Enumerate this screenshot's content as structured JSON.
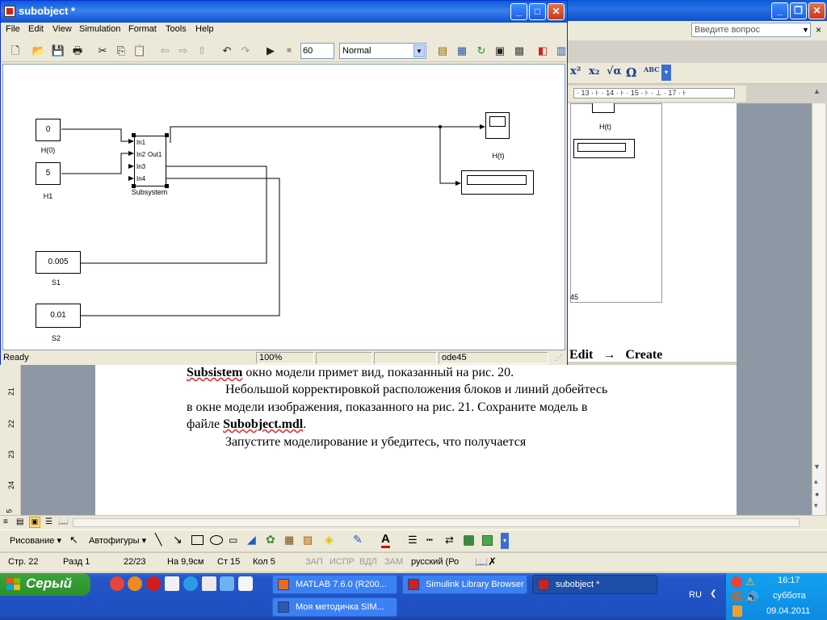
{
  "word": {
    "ask_placeholder": "Введите вопрос",
    "ruler_text": "· 13 · ⊦ · 14 · ⊦ · 15 · ⊦ · ⊥ · 17 · ⊦",
    "left_ruler_labels": [
      "21",
      "22",
      "23",
      "24",
      "5"
    ],
    "fig_labels": {
      "ht": "H(t)",
      "bottom": "45"
    },
    "format_symbols": {
      "superscript": "x²",
      "subscript": "x₂",
      "equation": "√α",
      "omega": "Ω",
      "spell": "ABC"
    },
    "paragraphs": {
      "edit_create": "Edit  →  Create",
      "line1": "Subsistem окно модели примет вид, показанный на рис. 20.",
      "line2": "Небольшой корректировкой расположения блоков и линий добейтесь",
      "line3": "в  окне  модели  изображения,  показанного  на  рис.  21.  Сохраните  модель  в",
      "line4_pre": "файле ",
      "line4_bold": "Subobject.mdl",
      "line4_post": ".",
      "line5": "Запустите моделирование и убедитесь, что получается"
    },
    "drawbar": {
      "draw_label": "Рисование ▾",
      "autoshapes_label": "Автофигуры ▾"
    },
    "status": {
      "page": "Стр. 22",
      "section": "Разд 1",
      "pages": "22/23",
      "position": "На 9,9см",
      "line": "Ст 15",
      "column": "Кол 5",
      "rec": "ЗАП",
      "trk": "ИСПР",
      "ext": "ВДЛ",
      "ovr": "ЗАМ",
      "language": "русский (Ро"
    }
  },
  "simulink": {
    "title": "subobject *",
    "menu": [
      "File",
      "Edit",
      "View",
      "Simulation",
      "Format",
      "Tools",
      "Help"
    ],
    "stop_time": "60",
    "sim_mode": "Normal",
    "blocks": {
      "h0": {
        "value": "0",
        "label": "H(0)"
      },
      "h1": {
        "value": "5",
        "label": "H1"
      },
      "s1": {
        "value": "0.005",
        "label": "S1"
      },
      "s2": {
        "value": "0.01",
        "label": "S2"
      },
      "subsystem": {
        "label": "Subsystem",
        "inports": [
          "In1",
          "In2",
          "In3",
          "In4"
        ],
        "outport": "Out1"
      },
      "scope": {
        "label": "H(t)"
      }
    },
    "status": {
      "state": "Ready",
      "zoom": "100%",
      "solver": "ode45"
    }
  },
  "taskbar": {
    "start_label": "Серый",
    "tasks": [
      {
        "label": "MATLAB  7.6.0 (R200...",
        "active": false
      },
      {
        "label": "Simulink Library Browser",
        "active": false
      },
      {
        "label": "subobject *",
        "active": true
      },
      {
        "label": "Моя методичка SIM...",
        "active": false
      }
    ],
    "language": "RU",
    "time": "16:17",
    "day": "суббота",
    "date": "09.04.2011"
  }
}
